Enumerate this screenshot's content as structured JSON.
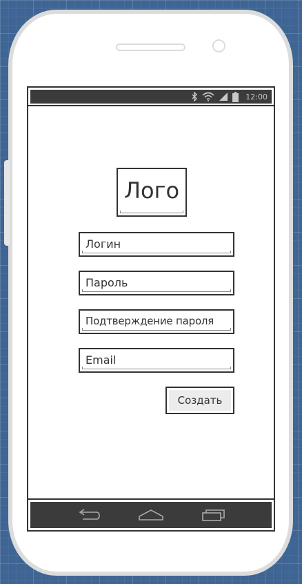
{
  "status_bar": {
    "time": "12:00",
    "icons": [
      "bluetooth-icon",
      "wifi-icon",
      "signal-icon",
      "battery-icon"
    ]
  },
  "logo": {
    "text": "Лого"
  },
  "form": {
    "login_field": "Логин",
    "password_field": "Пароль",
    "confirm_password_field": "Подтверждение пароля",
    "email_field": "Email",
    "create_button": "Создать"
  },
  "nav_bar": {
    "icons": [
      "back-icon",
      "home-icon",
      "recent-apps-icon"
    ]
  },
  "colors": {
    "background": "#3f6594",
    "phone_frame": "#dcdcdc",
    "bar_dark": "#3b3b3b",
    "stroke": "#333333",
    "button_fill": "#ececec"
  }
}
